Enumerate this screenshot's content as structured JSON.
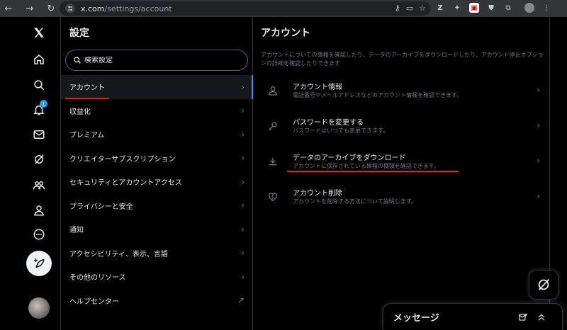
{
  "browser": {
    "url_host": "x.com",
    "url_path": "/settings/account"
  },
  "nav": {
    "notification_count": "1"
  },
  "settings": {
    "title": "設定",
    "search_placeholder": "検索設定",
    "items": [
      {
        "label": "アカウント"
      },
      {
        "label": "収益化"
      },
      {
        "label": "プレミアム"
      },
      {
        "label": "クリエイターサブスクリプション"
      },
      {
        "label": "セキュリティとアカウントアクセス"
      },
      {
        "label": "プライバシーと安全"
      },
      {
        "label": "通知"
      },
      {
        "label": "アクセシビリティ、表示、言語"
      },
      {
        "label": "その他のリソース"
      },
      {
        "label": "ヘルプセンター"
      }
    ]
  },
  "account": {
    "title": "アカウント",
    "description": "アカウントについての情報を確認したり、データのアーカイブをダウンロードしたり、アカウント停止オプションの詳細を確認したりできます",
    "options": [
      {
        "title": "アカウント情報",
        "subtitle": "電話番号やメールアドレスなどのアカウント情報を確認できます。",
        "icon": "person-icon"
      },
      {
        "title": "パスワードを変更する",
        "subtitle": "パスワードはいつでも変更できます。",
        "icon": "key-icon"
      },
      {
        "title": "データのアーカイブをダウンロード",
        "subtitle": "アカウントに保存されている情報の種類を確認できます。",
        "icon": "download-icon"
      },
      {
        "title": "アカウント削除",
        "subtitle": "アカウントを削除する方法について説明します。",
        "icon": "broken-heart-icon"
      }
    ]
  },
  "messages": {
    "label": "メッセージ"
  },
  "colors": {
    "accent": "#1d9bf0",
    "annotation": "#e0202a",
    "background": "#000000"
  }
}
